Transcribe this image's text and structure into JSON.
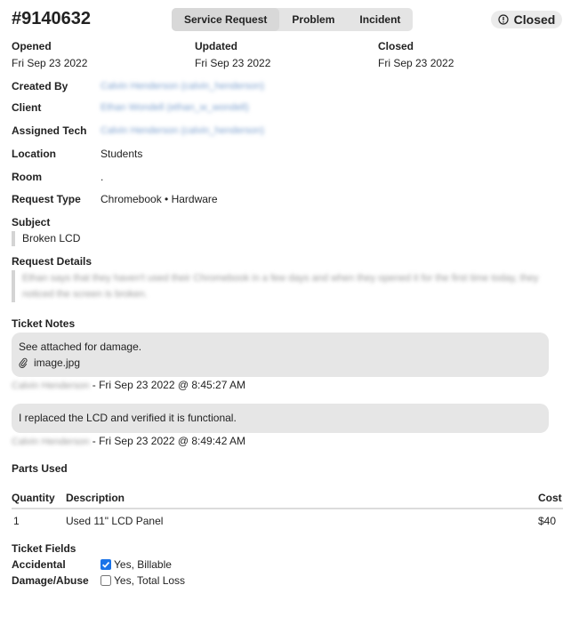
{
  "ticket": {
    "id": "#9140632",
    "status": "Closed",
    "type_tabs": [
      {
        "label": "Service Request",
        "active": true
      },
      {
        "label": "Problem",
        "active": false
      },
      {
        "label": "Incident",
        "active": false
      }
    ]
  },
  "dates": {
    "opened_label": "Opened",
    "opened": "Fri Sep 23 2022",
    "updated_label": "Updated",
    "updated": "Fri Sep 23 2022",
    "closed_label": "Closed",
    "closed": "Fri Sep 23 2022"
  },
  "fields": {
    "created_by_label": "Created By",
    "created_by": "Calvin Henderson (calvin_henderson)",
    "client_label": "Client",
    "client": "Ethan Wondell (ethan_w_wondell)",
    "assigned_label": "Assigned Tech",
    "assigned": "Calvin Henderson (calvin_henderson)",
    "location_label": "Location",
    "location": "Students",
    "room_label": "Room",
    "room": ".",
    "request_type_label": "Request Type",
    "request_type": "Chromebook • Hardware"
  },
  "subject": {
    "label": "Subject",
    "value": "Broken LCD"
  },
  "details": {
    "label": "Request Details",
    "line1": "Ethan says that they haven't used their Chromebook in a few days and when they opened it for the first time today, they",
    "line2": "noticed the screen is broken."
  },
  "notes": {
    "label": "Ticket Notes",
    "items": [
      {
        "text": "See attached for damage.",
        "attachment": "image.jpg",
        "author": "Calvin Henderson",
        "timestamp": " - Fri Sep 23 2022 @ 8:45:27 AM"
      },
      {
        "text": "I replaced the LCD and verified it is functional.",
        "author": "Calvin Henderson",
        "timestamp": " - Fri Sep 23 2022 @ 8:49:42 AM"
      }
    ]
  },
  "parts": {
    "label": "Parts Used",
    "headers": {
      "qty": "Quantity",
      "desc": "Description",
      "cost": "Cost"
    },
    "rows": [
      {
        "qty": "1",
        "desc": "Used 11\" LCD Panel",
        "cost": "$40"
      }
    ]
  },
  "ticket_fields": {
    "label": "Ticket Fields",
    "accidental_label": "Accidental",
    "accidental_option": "Yes, Billable",
    "accidental_checked": true,
    "damage_label": "Damage/Abuse",
    "damage_option": "Yes, Total Loss",
    "damage_checked": false
  },
  "colors": {
    "checkbox_accent": "#1a73e8",
    "link_blurred": "#7fa2cf"
  }
}
